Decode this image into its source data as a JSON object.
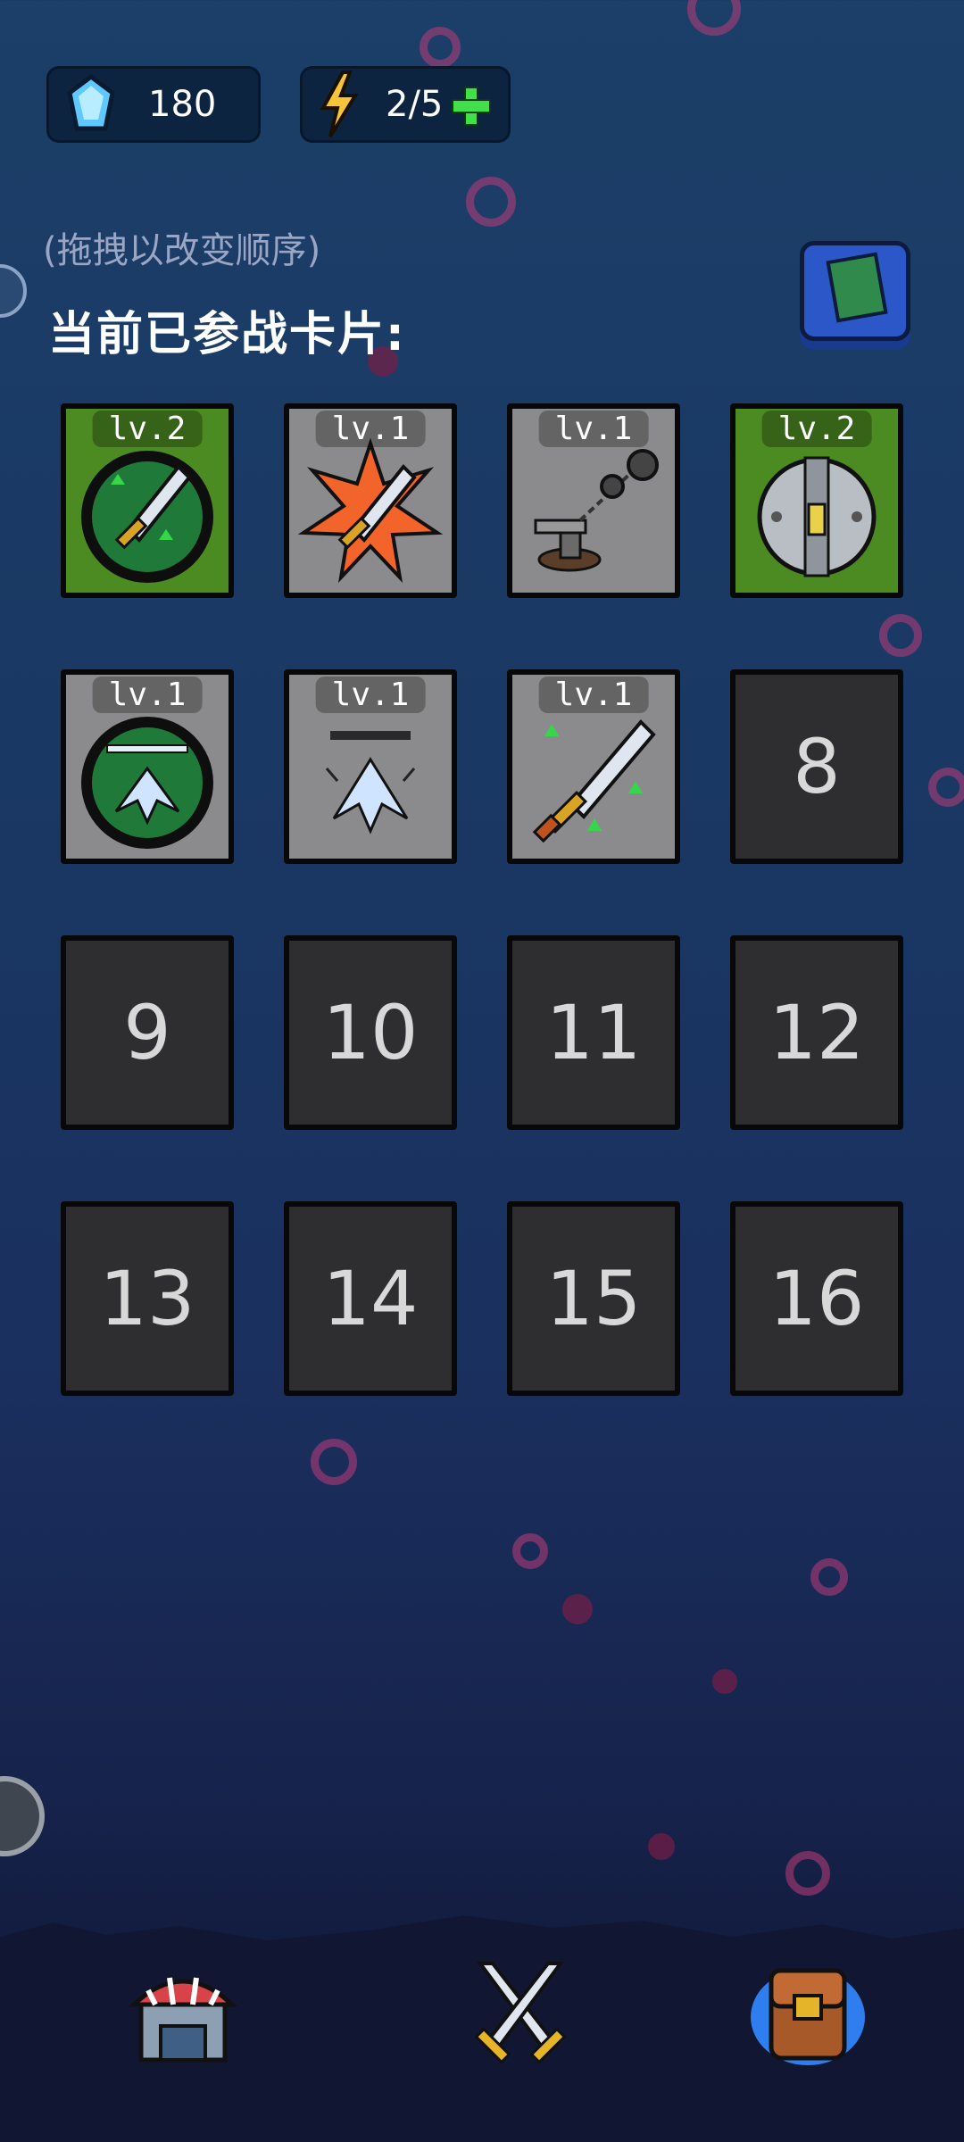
{
  "resources": {
    "gems": "180",
    "energy": "2/5"
  },
  "hint": "(拖拽以改变顺序)",
  "section_title": "当前已参战卡片:",
  "cards": [
    {
      "slot": "1",
      "level": "lv.2",
      "icon": "sword-upgrade-icon",
      "bg": "green"
    },
    {
      "slot": "2",
      "level": "lv.1",
      "icon": "sword-burst-icon",
      "bg": "gray"
    },
    {
      "slot": "3",
      "level": "lv.1",
      "icon": "ball-chain-turret-icon",
      "bg": "gray"
    },
    {
      "slot": "4",
      "level": "lv.2",
      "icon": "round-robot-icon",
      "bg": "green"
    },
    {
      "slot": "5",
      "level": "lv.1",
      "icon": "arrow-upgrade-icon",
      "bg": "gray"
    },
    {
      "slot": "6",
      "level": "lv.1",
      "icon": "arrow-up-icon",
      "bg": "gray"
    },
    {
      "slot": "7",
      "level": "lv.1",
      "icon": "sword-arrows-icon",
      "bg": "gray"
    },
    {
      "slot": "8",
      "empty": true
    },
    {
      "slot": "9",
      "empty": true
    },
    {
      "slot": "10",
      "empty": true
    },
    {
      "slot": "11",
      "empty": true
    },
    {
      "slot": "12",
      "empty": true
    },
    {
      "slot": "13",
      "empty": true
    },
    {
      "slot": "14",
      "empty": true
    },
    {
      "slot": "15",
      "empty": true
    },
    {
      "slot": "16",
      "empty": true
    }
  ],
  "nav": [
    "shop-icon",
    "crossed-swords-icon",
    "backpack-icon"
  ],
  "colors": {
    "card_green": "#4c8a22",
    "card_gray": "#8b8b8d",
    "empty_slot": "#2e2e30",
    "plus_green": "#3fe04a"
  }
}
